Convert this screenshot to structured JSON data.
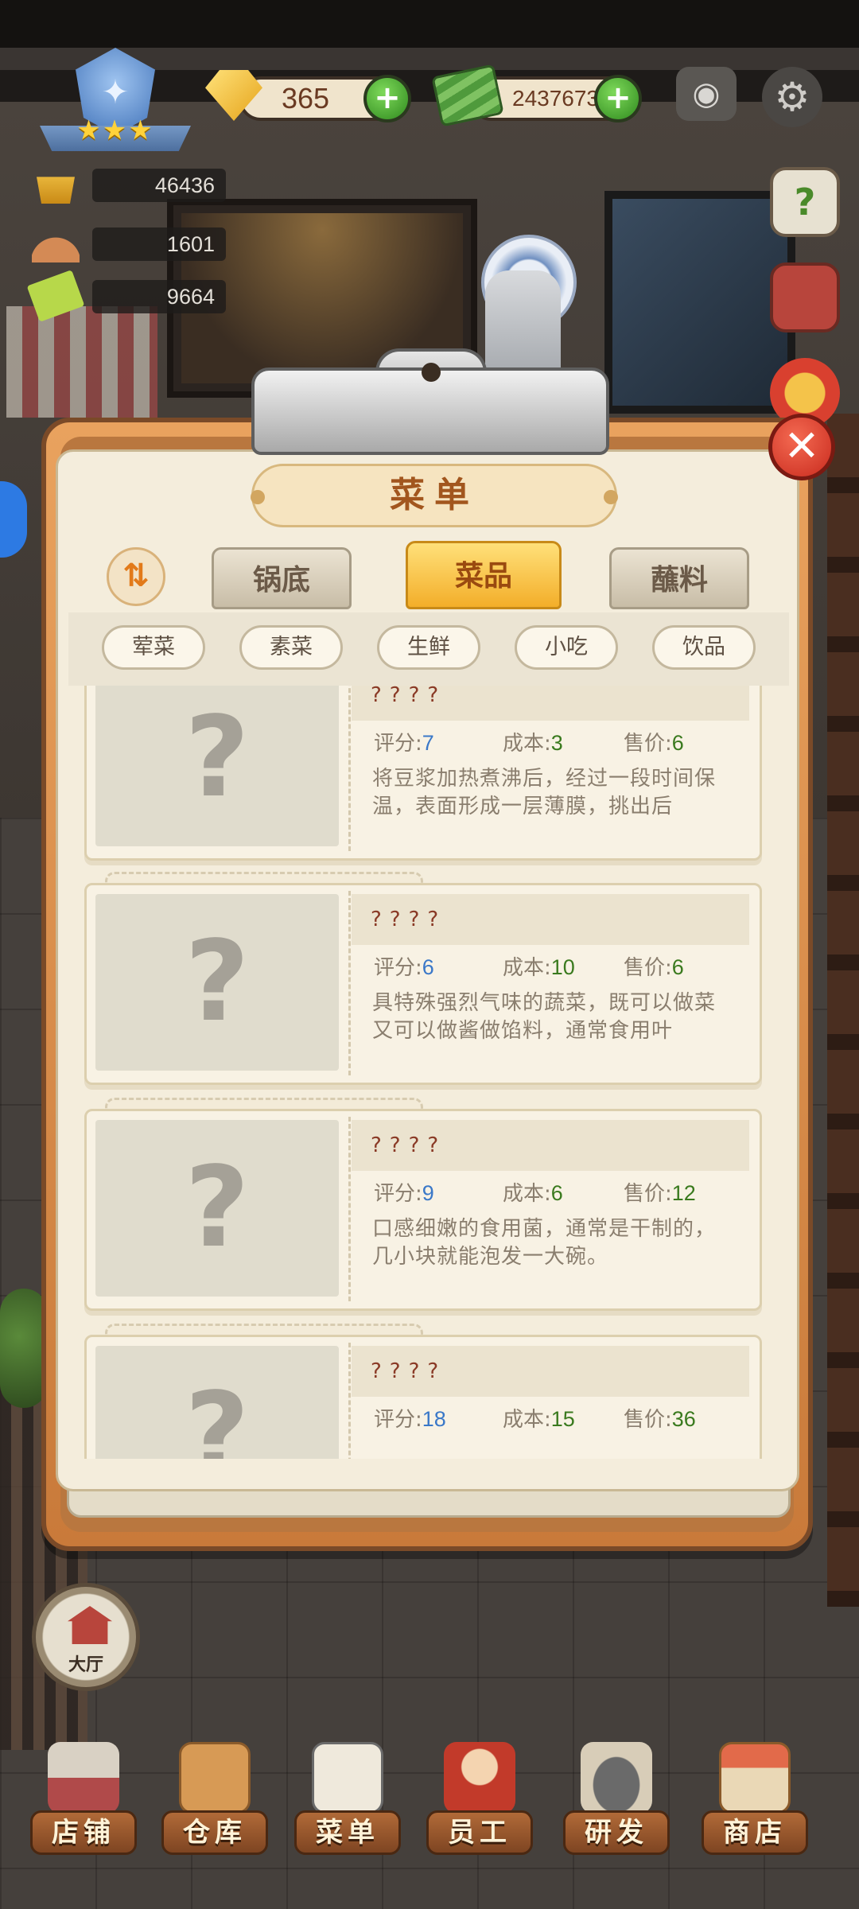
{
  "hud": {
    "gems": "365",
    "cash": "2437673",
    "stats": [
      "46436",
      "1601",
      "9664"
    ],
    "plus_glyph": "+",
    "camera_icon": "camera-icon",
    "settings_icon": "gear-icon",
    "stars": "★★★"
  },
  "side_buttons": {
    "guide_glyph": "?"
  },
  "dialog": {
    "title": "菜单",
    "close_glyph": "✕",
    "sort_glyph": "⇅",
    "tabs": [
      {
        "label": "锅底",
        "active": false
      },
      {
        "label": "菜品",
        "active": true
      },
      {
        "label": "蘸料",
        "active": false
      }
    ],
    "categories": [
      "荤菜",
      "素菜",
      "生鲜",
      "小吃",
      "饮品"
    ],
    "stat_labels": {
      "rating": "评分:",
      "cost": "成本:",
      "price": "售价:"
    },
    "items": [
      {
        "name": "????",
        "placeholder": "?",
        "rating": "7",
        "cost": "3",
        "price": "6",
        "desc": "将豆浆加热煮沸后，经过一段时间保温，表面形成一层薄膜，挑出后"
      },
      {
        "name": "????",
        "placeholder": "?",
        "rating": "6",
        "cost": "10",
        "price": "6",
        "desc": "具特殊强烈气味的蔬菜，既可以做菜又可以做酱做馅料，通常食用叶"
      },
      {
        "name": "????",
        "placeholder": "?",
        "rating": "9",
        "cost": "6",
        "price": "12",
        "desc": "口感细嫩的食用菌，通常是干制的，几小块就能泡发一大碗。"
      },
      {
        "name": "????",
        "placeholder": "?",
        "rating": "18",
        "cost": "15",
        "price": "36",
        "desc": ""
      }
    ]
  },
  "hall_button": {
    "label": "大厅"
  },
  "bottom_nav": [
    "店铺",
    "仓库",
    "菜单",
    "员工",
    "研发",
    "商店"
  ]
}
